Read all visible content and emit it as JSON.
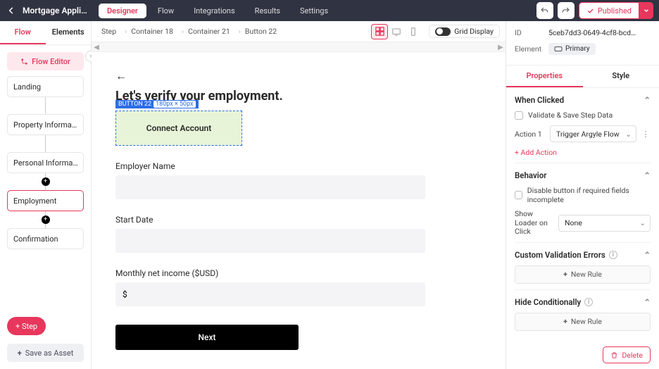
{
  "app_title": "Mortgage Applic…",
  "topnav": {
    "tabs": [
      "Designer",
      "Flow",
      "Integrations",
      "Results",
      "Settings"
    ],
    "published_label": "Published"
  },
  "left": {
    "tabs": [
      "Flow",
      "Elements"
    ],
    "flow_editor_label": "Flow Editor",
    "steps": [
      "Landing",
      "Property Informa…",
      "Personal Informa…",
      "Employment",
      "Confirmation"
    ],
    "add_step_label": "+ Step",
    "save_asset_label": "Save as Asset"
  },
  "canvasbar": {
    "crumbs": [
      "Step",
      "Container 18",
      "Container 21",
      "Button 22"
    ],
    "grid_label": "Grid Display"
  },
  "canvas": {
    "heading": "Let's verify your employment.",
    "button_tag": "BUTTON 22",
    "button_dims": "180px × 50px",
    "connect_label": "Connect Account",
    "fields": {
      "employer_label": "Employer Name",
      "start_label": "Start Date",
      "income_label": "Monthly net income ($USD)",
      "income_prefix": "$"
    },
    "next_label": "Next"
  },
  "right": {
    "id_label": "ID",
    "id_value": "5ceb7dd3-0649-4cf8-bcd…",
    "element_label": "Element",
    "element_chip": "Primary",
    "ptabs": [
      "Properties",
      "Style"
    ],
    "sections": {
      "when_clicked": {
        "title": "When Clicked",
        "validate_label": "Validate & Save Step Data",
        "action1_label": "Action 1",
        "action1_value": "Trigger Argyle Flow",
        "add_action_label": "+ Add Action"
      },
      "behavior": {
        "title": "Behavior",
        "disable_label": "Disable button if required fields incomplete",
        "loader_label": "Show Loader on Click",
        "loader_value": "None"
      },
      "cve": {
        "title": "Custom Validation Errors",
        "rule_label": "New Rule"
      },
      "hide": {
        "title": "Hide Conditionally",
        "rule_label": "New Rule"
      }
    },
    "delete_label": "Delete"
  }
}
